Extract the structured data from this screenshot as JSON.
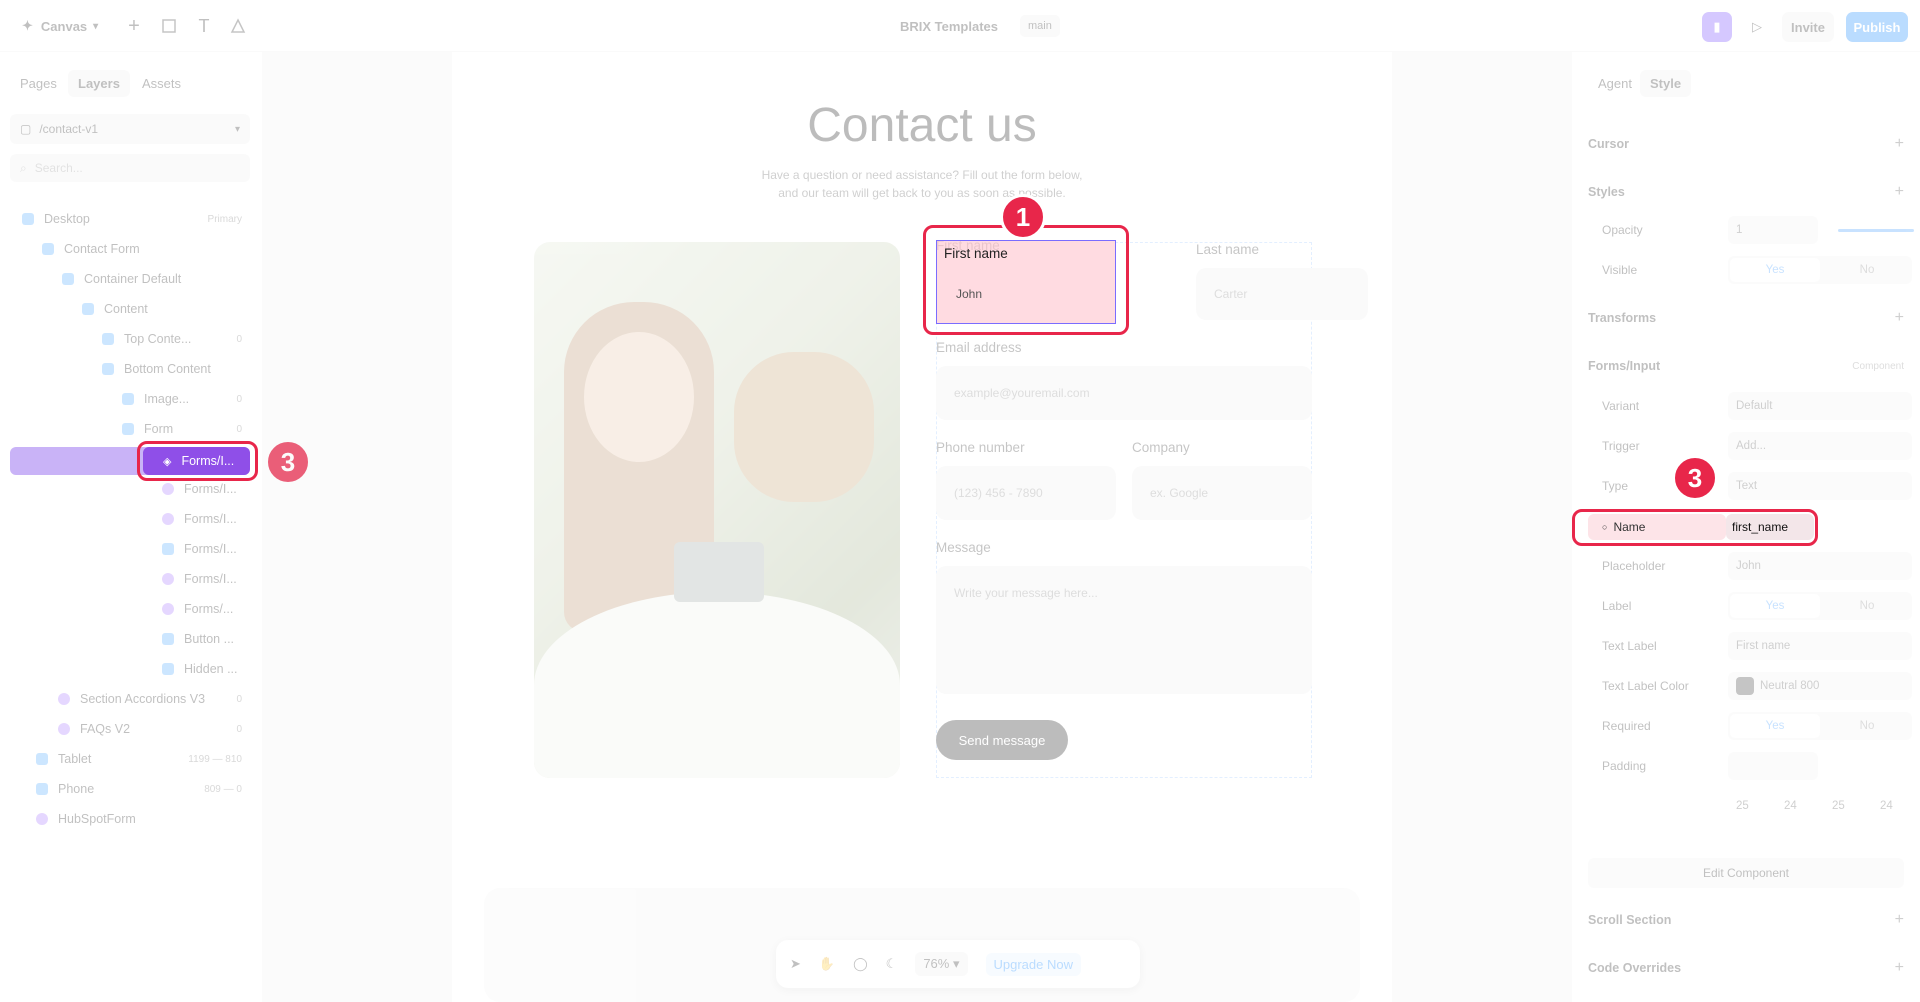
{
  "topbar": {
    "app_menu": "Canvas",
    "project_title": "BRIX Templates",
    "branch": "main",
    "invite": "Invite",
    "publish": "Publish"
  },
  "left": {
    "tabs": [
      "Pages",
      "Layers",
      "Assets"
    ],
    "page_select": "/contact-v1",
    "search_placeholder": "Search...",
    "layers": [
      {
        "label": "Desktop",
        "meta": "Primary"
      },
      {
        "label": "Contact Form",
        "meta": ""
      },
      {
        "label": "Container Default",
        "meta": ""
      },
      {
        "label": "Content",
        "meta": ""
      },
      {
        "label": "Top Conte...",
        "meta": "0"
      },
      {
        "label": "Bottom Content",
        "meta": ""
      },
      {
        "label": "Image...",
        "meta": "0"
      },
      {
        "label": "Form",
        "meta": "0"
      },
      {
        "label": "Forms/I...",
        "meta": ""
      },
      {
        "label": "Forms/I...",
        "meta": ""
      },
      {
        "label": "Forms/I...",
        "meta": ""
      },
      {
        "label": "Forms/I...",
        "meta": ""
      },
      {
        "label": "Forms/I...",
        "meta": ""
      },
      {
        "label": "Forms/...",
        "meta": ""
      },
      {
        "label": "Button ...",
        "meta": ""
      },
      {
        "label": "Hidden ...",
        "meta": ""
      },
      {
        "label": "Section Accordions V3",
        "meta": "0"
      },
      {
        "label": "FAQs V2",
        "meta": "0"
      },
      {
        "label": "Tablet",
        "meta": "1199 — 810"
      },
      {
        "label": "Phone",
        "meta": "809 — 0"
      },
      {
        "label": "HubSpotForm",
        "meta": ""
      }
    ]
  },
  "page": {
    "title": "Contact us",
    "subtitle_1": "Have a question or need assistance? Fill out the form below,",
    "subtitle_2": "and our team will get back to you as soon as possible.",
    "first_name_label": "First name",
    "first_name_placeholder": "John",
    "last_name_label": "Last name",
    "last_name_placeholder": "Carter",
    "email_label": "Email address",
    "email_placeholder": "example@youremail.com",
    "phone_label": "Phone number",
    "phone_placeholder": "(123) 456 - 7890",
    "company_label": "Company",
    "company_placeholder": "ex. Google",
    "message_label": "Message",
    "message_placeholder": "Write your message here...",
    "send_button": "Send message"
  },
  "bottom_toolbar": {
    "zoom": "76%",
    "upgrade": "Upgrade Now"
  },
  "right": {
    "tabs": [
      "Agent",
      "Style"
    ],
    "cursor": "Cursor",
    "styles": "Styles",
    "opacity_label": "Opacity",
    "opacity_value": "1",
    "visible_label": "Visible",
    "yes": "Yes",
    "no": "No",
    "transforms": "Transforms",
    "component_section": "Forms/Input",
    "component_tag": "Component",
    "variant_label": "Variant",
    "variant_value": "Default",
    "trigger_label": "Trigger",
    "trigger_value": "Add...",
    "type_label": "Type",
    "type_value": "Text",
    "name_label": "Name",
    "name_value": "first_name",
    "placeholder_label": "Placeholder",
    "placeholder_value": "John",
    "label_label": "Label",
    "text_label_label": "Text Label",
    "text_label_value": "First name",
    "text_label_color_label": "Text Label Color",
    "text_label_color_value": "Neutral 800",
    "required_label": "Required",
    "padding_label": "Padding",
    "padding_values": [
      "25",
      "24",
      "25",
      "24"
    ],
    "edit_component": "Edit Component",
    "scroll_section": "Scroll Section",
    "code_overrides": "Code Overrides"
  },
  "annotations": {
    "badge_1": "1",
    "badge_3a": "3",
    "badge_3b": "3",
    "selected_layer": "Forms/I..."
  },
  "colors": {
    "highlight": "#e8264a",
    "accent_blue": "#3d9bff",
    "selection_purple": "#8f4fe8"
  }
}
